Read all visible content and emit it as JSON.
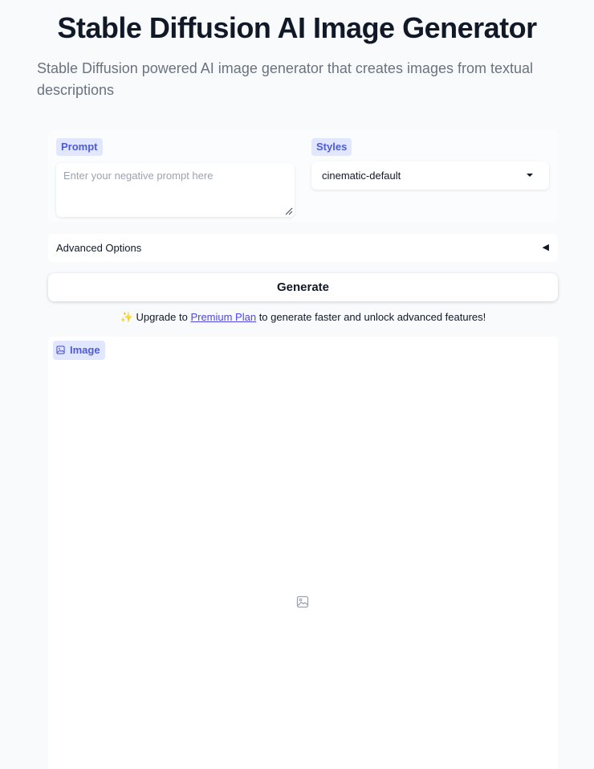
{
  "header": {
    "title": "Stable Diffusion AI Image Generator",
    "subtitle": "Stable Diffusion powered AI image generator that creates images from textual descriptions"
  },
  "prompt": {
    "label": "Prompt",
    "placeholder": "Enter your negative prompt here",
    "value": ""
  },
  "styles": {
    "label": "Styles",
    "selected": "cinematic-default"
  },
  "advanced": {
    "label": "Advanced Options",
    "arrow": "◀"
  },
  "generate": {
    "label": "Generate"
  },
  "upgrade": {
    "sparkle": "✨",
    "prefix": " Upgrade to ",
    "link": "Premium Plan",
    "suffix": " to generate faster and unlock advanced features!"
  },
  "output": {
    "label": "Image",
    "icon": "image-icon"
  },
  "colors": {
    "accent": "#4f5bd5",
    "accent_bg": "#e0e7ff",
    "link": "#4f46e5",
    "background": "#f8fafc"
  }
}
